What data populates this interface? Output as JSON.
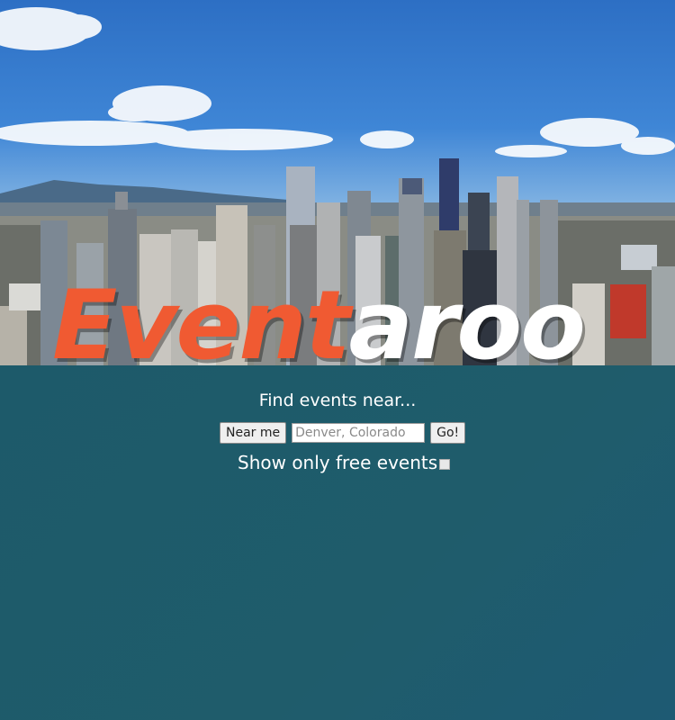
{
  "hero": {
    "image": "city-skyline-photo",
    "logo_part1": "Event",
    "logo_part2": "aroo",
    "logo_color1": "#f05a32",
    "logo_color2": "#ffffff"
  },
  "search": {
    "heading": "Find events near...",
    "near_me_label": "Near me",
    "location_placeholder": "Denver, Colorado",
    "go_label": "Go!",
    "free_label": "Show only free events",
    "free_checked": false
  },
  "colors": {
    "panel_bg": "#1f5c6b",
    "accent": "#f05a32"
  }
}
